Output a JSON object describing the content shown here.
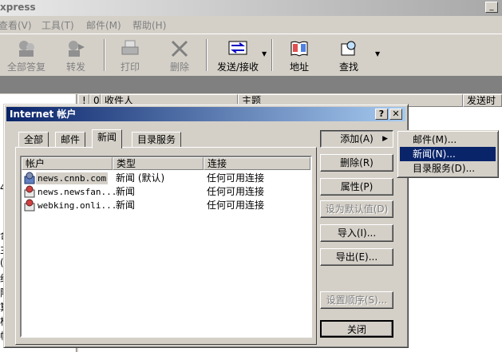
{
  "app": {
    "title": "xpress",
    "menu": [
      "查看(V)",
      "工具(T)",
      "邮件(M)",
      "帮助(H)"
    ],
    "toolbar": [
      {
        "label": "全部答复",
        "icon": "reply-all-icon",
        "disabled": true
      },
      {
        "label": "转发",
        "icon": "forward-icon",
        "disabled": true
      },
      {
        "label": "打印",
        "icon": "print-icon",
        "disabled": true
      },
      {
        "label": "删除",
        "icon": "delete-icon",
        "disabled": true
      },
      {
        "label": "发送/接收",
        "icon": "send-receive-icon",
        "disabled": false
      },
      {
        "label": "地址",
        "icon": "address-book-icon",
        "disabled": false
      },
      {
        "label": "查找",
        "icon": "find-icon",
        "disabled": false
      }
    ],
    "list_columns": [
      "!",
      "0",
      "收件人",
      "主题",
      "发送时间"
    ],
    "left_fragments": [
      "4",
      "合",
      "主",
      "(",
      "约",
      "阿",
      "算",
      "桥",
      "帧"
    ]
  },
  "dialog": {
    "title": "Internet 帐户",
    "help_btn": "?",
    "close_btn": "✕",
    "tabs": [
      "全部",
      "邮件",
      "新闻",
      "目录服务"
    ],
    "columns": [
      "帐户",
      "类型",
      "连接"
    ],
    "accounts": [
      {
        "name": "news.cnnb.com",
        "type": "新闻 (默认)",
        "conn": "任何可用连接"
      },
      {
        "name": "news.newsfan...",
        "type": "新闻",
        "conn": "任何可用连接"
      },
      {
        "name": "webking.onli...",
        "type": "新闻",
        "conn": "任何可用连接"
      }
    ],
    "buttons": {
      "add": "添加(A)",
      "remove": "删除(R)",
      "properties": "属性(P)",
      "set_default": "设为默认值(D)",
      "import": "导入(I)...",
      "export": "导出(E)...",
      "set_order": "设置顺序(S)...",
      "close": "关闭"
    }
  },
  "popup_menu": {
    "items": [
      "邮件(M)...",
      "新闻(N)...",
      "目录服务(D)..."
    ]
  }
}
